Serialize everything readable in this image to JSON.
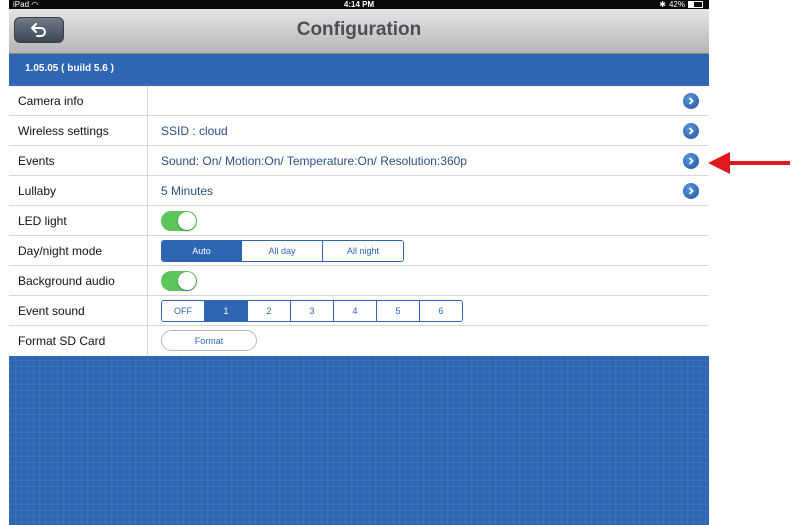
{
  "status_bar": {
    "carrier": "iPad",
    "time": "4:14 PM",
    "battery": "42%",
    "battery_level": 0.42
  },
  "nav": {
    "title": "Configuration",
    "back_icon": "back-arrow-icon"
  },
  "version": "1.05.05 ( build 5.6 )",
  "rows": {
    "camera_info": {
      "label": "Camera info"
    },
    "wireless": {
      "label": "Wireless settings",
      "value": "SSID : cloud"
    },
    "events": {
      "label": "Events",
      "value": "Sound: On/ Motion:On/ Temperature:On/ Resolution:360p"
    },
    "lullaby": {
      "label": "Lullaby",
      "value": "5 Minutes"
    },
    "led": {
      "label": "LED light",
      "state": "on"
    },
    "daynight": {
      "label": "Day/night mode",
      "options": [
        "Auto",
        "All day",
        "All night"
      ],
      "selected": "Auto"
    },
    "bg_audio": {
      "label": "Background audio",
      "state": "on"
    },
    "event_sound": {
      "label": "Event sound",
      "options": [
        "OFF",
        "1",
        "2",
        "3",
        "4",
        "5",
        "6"
      ],
      "selected": "1"
    },
    "format_sd": {
      "label": "Format SD Card",
      "button": "Format"
    }
  },
  "colors": {
    "accent": "#2e66b3",
    "toggle_on": "#5cc65c",
    "annotation_arrow": "#e0191e"
  }
}
